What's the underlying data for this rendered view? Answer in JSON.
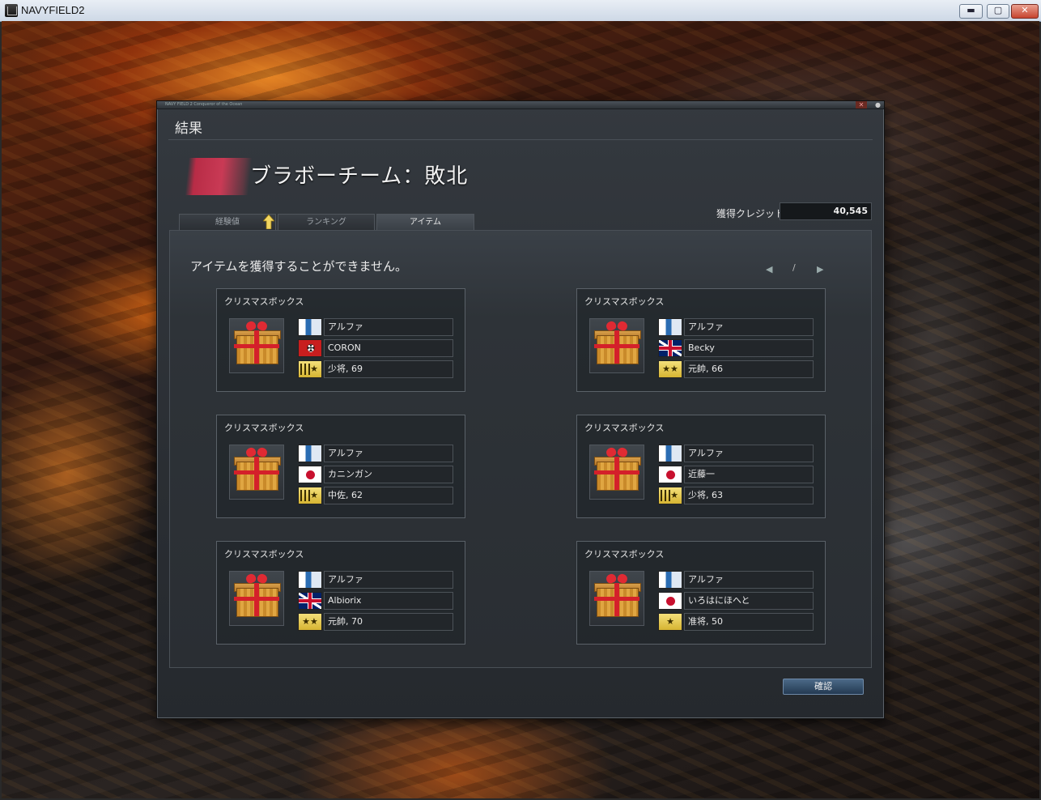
{
  "window": {
    "title": "NAVYFIELD2",
    "min": "▬",
    "max": "▢",
    "close": "✕"
  },
  "dialog": {
    "strip_text": "NAVY FIELD 2 Conqueror of the Ocean",
    "title": "結果",
    "result_title": "ブラボーチーム：敗北",
    "credit_label": "獲得クレジット",
    "credit_value": "40,545",
    "tabs": [
      "経験値",
      "ランキング",
      "アイテム"
    ],
    "active_tab": "アイテム",
    "no_item_message": "アイテムを獲得することができません。",
    "pager": {
      "prev": "◀",
      "sep": "/",
      "next": "▶"
    },
    "confirm_label": "確認",
    "colors": {
      "team_flag": "#c93a55",
      "confirm": "#3a5573"
    }
  },
  "cards": [
    {
      "title": "クリスマスボックス",
      "team": "アルファ",
      "nation_icon": "germany-flag-icon",
      "player": "CORON",
      "rank": "少将, 69",
      "rank_icon": "★"
    },
    {
      "title": "クリスマスボックス",
      "team": "アルファ",
      "nation_icon": "uk-flag-icon",
      "player": "Becky",
      "rank": "元帥, 66",
      "rank_icon": "★★"
    },
    {
      "title": "クリスマスボックス",
      "team": "アルファ",
      "nation_icon": "japan-flag-icon",
      "player": "カニンガン",
      "rank": "中佐, 62",
      "rank_icon": "★"
    },
    {
      "title": "クリスマスボックス",
      "team": "アルファ",
      "nation_icon": "japan-flag-icon",
      "player": "近藤一",
      "rank": "少将, 63",
      "rank_icon": "★"
    },
    {
      "title": "クリスマスボックス",
      "team": "アルファ",
      "nation_icon": "uk-flag-icon",
      "player": "Albiorix",
      "rank": "元帥, 70",
      "rank_icon": "★★"
    },
    {
      "title": "クリスマスボックス",
      "team": "アルファ",
      "nation_icon": "japan-flag-icon",
      "player": "いろはにほへと",
      "rank": "准将, 50",
      "rank_icon": "★"
    }
  ]
}
